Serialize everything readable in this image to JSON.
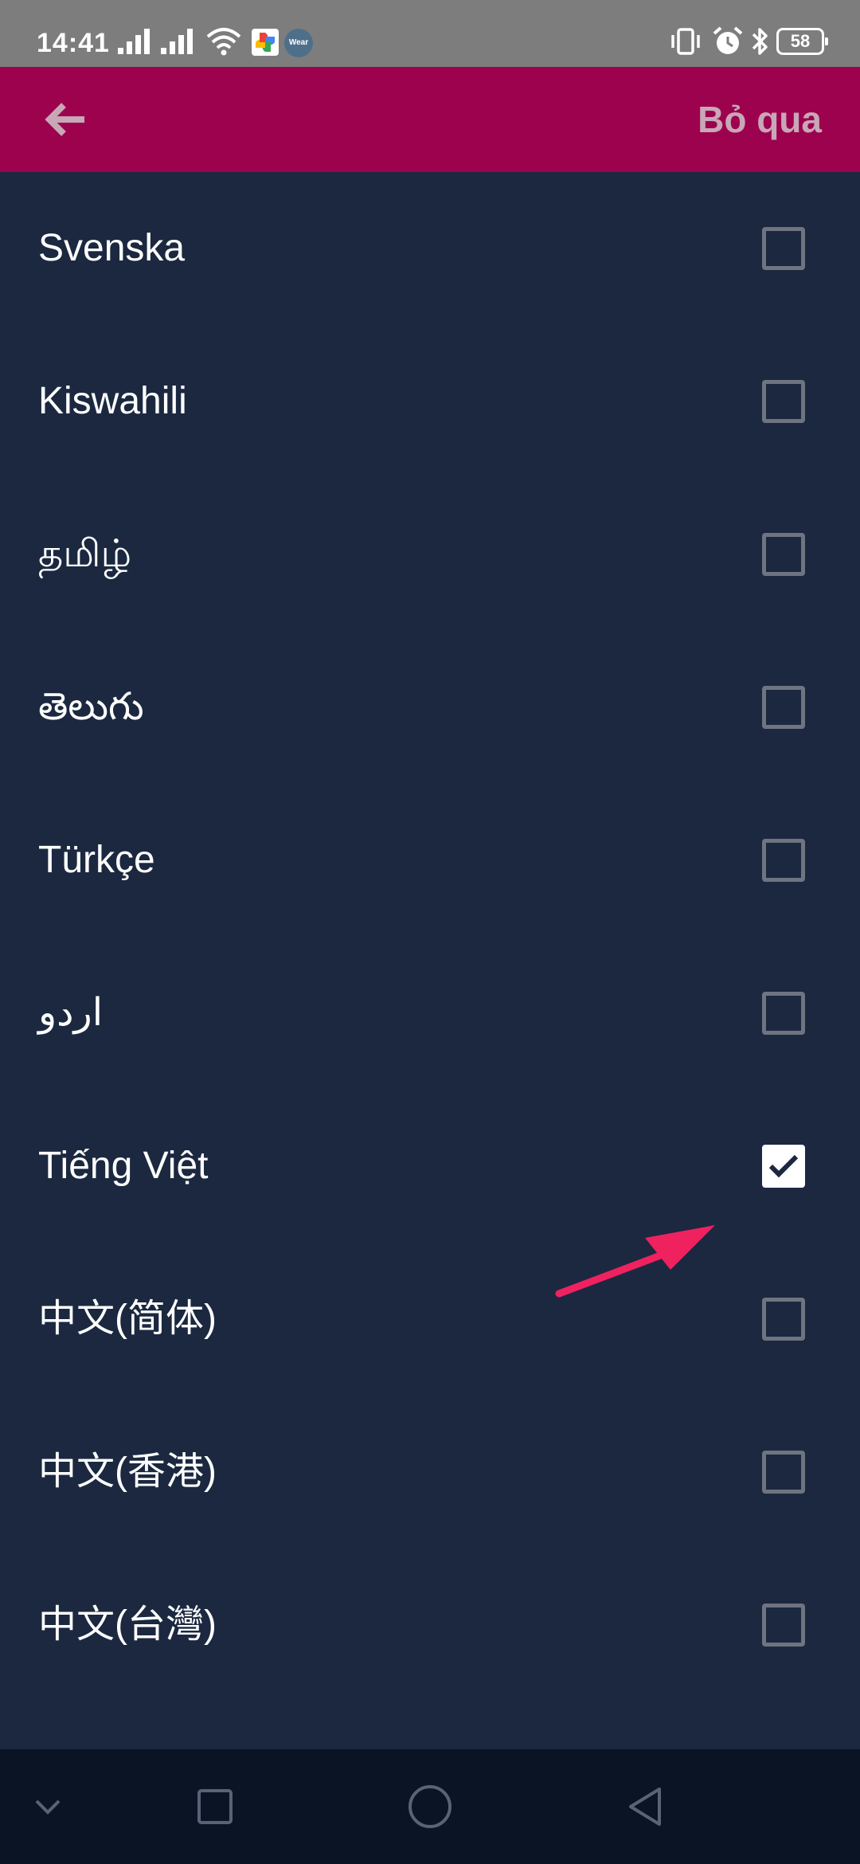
{
  "status_bar": {
    "time": "14:41",
    "battery": "58",
    "wear_label": "Wear",
    "icons": [
      "signal-icon",
      "signal-icon",
      "wifi-icon",
      "google-photos-icon",
      "wear-os-icon",
      "vibrate-icon",
      "alarm-icon",
      "bluetooth-icon",
      "battery-icon"
    ]
  },
  "app_bar": {
    "back_icon": "arrow-left-icon",
    "skip_label": "Bỏ qua"
  },
  "languages": [
    {
      "label": "Svenska",
      "checked": false
    },
    {
      "label": "Kiswahili",
      "checked": false
    },
    {
      "label": "தமிழ்",
      "checked": false
    },
    {
      "label": "తెలుగు",
      "checked": false
    },
    {
      "label": "Türkçe",
      "checked": false
    },
    {
      "label": "اردو",
      "checked": false
    },
    {
      "label": "Tiếng Việt",
      "checked": true
    },
    {
      "label": "中文(简体)",
      "checked": false
    },
    {
      "label": "中文(香港)",
      "checked": false
    },
    {
      "label": "中文(台灣)",
      "checked": false
    }
  ],
  "nav_bar": {
    "buttons": [
      "chevron-down-icon",
      "recent-apps-icon",
      "home-icon",
      "back-icon"
    ]
  },
  "colors": {
    "background": "#1b2840",
    "app_bar": "#9d024f",
    "skip_text": "#c8a7b7",
    "annotation_arrow": "#f0215f",
    "checkbox_border": "#6e7480"
  }
}
